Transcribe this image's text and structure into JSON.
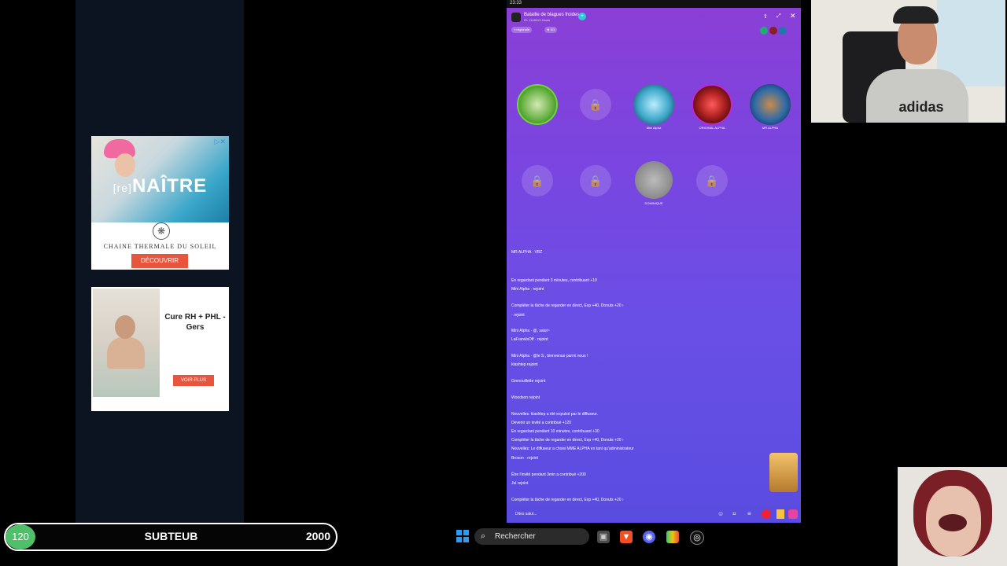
{
  "ads": {
    "ad1": {
      "headline_prefix": "[re]",
      "headline": "NAÎTRE",
      "brand": "CHAINE THERMALE DU SOLEIL",
      "cta": "DÉCOUVRIR"
    },
    "ad2": {
      "title": "Cure RH + PHL - Gers",
      "cta": "VOIR PLUS"
    }
  },
  "app": {
    "status_time": "23:33",
    "room_title": "Bataille de blagues froides",
    "room_subtitle": "ID: 1148413 Hauts",
    "chip_region": "régionale",
    "chip_count": "0/1",
    "seats_row1": [
      {
        "type": "avatar",
        "color": "#5fae3c"
      },
      {
        "type": "lock"
      },
      {
        "type": "avatar",
        "color": "#3ba6c8",
        "name": "Mini Alpha"
      },
      {
        "type": "avatar",
        "color": "#b22222",
        "name": "ORIGINAL ALPHA"
      },
      {
        "type": "avatar",
        "color": "#2d6aa8",
        "name": "MR ALPHA"
      }
    ],
    "seats_row2": [
      {
        "type": "lock"
      },
      {
        "type": "lock"
      },
      {
        "type": "avatar",
        "color": "#8a8a8a",
        "name": "DOMINIQUE"
      },
      {
        "type": "lock"
      }
    ],
    "chat": [
      {
        "text": "MR ALPHA · VBZ"
      },
      {
        "text": "En regardant pendant 3 minutes, contribuant +10"
      },
      {
        "text": "Mini Alpha · rejoint"
      },
      {
        "text": "Compléter la tâche de regarder en direct, Exp +40, Donuts +20 ›"
      },
      {
        "text": "· rejoint"
      },
      {
        "text": "Mini Alpha · @, salut~"
      },
      {
        "text": "LaFrarwlsOff · rejoint"
      },
      {
        "text": "Mini Alpha · @le S., bienvenue parmi nous !"
      },
      {
        "text": "klashtep rejoint"
      },
      {
        "text": "Grenouillette rejoint"
      },
      {
        "text": "Woodson rejoint"
      },
      {
        "text": "Nouvelles: klashtep a été expulsé par le diffuseur."
      },
      {
        "text": "Devenir un invité a contribué +120"
      },
      {
        "text": "En regardant pendant 10 minutes, contribuant +30"
      },
      {
        "text": "Compléter la tâche de regarder en direct, Exp +40, Donuts +20 ›"
      },
      {
        "text": "Nouvelles: Le diffuseur a choisi MME ALPHA en tant qu'administrateur"
      },
      {
        "text": "Broson · rejoint"
      },
      {
        "text": "Être l'invité pendant 3min a contribué +200"
      },
      {
        "text": "Jul rejoint"
      },
      {
        "text": "Compléter la tâche de regarder en direct, Exp +40, Donuts +20 ›"
      }
    ],
    "input_placeholder": "Dites salut..."
  },
  "webcam": {
    "shirt_logo": "adidas"
  },
  "goal": {
    "count": "120",
    "label": "SUBTEUB",
    "target": "2000"
  },
  "taskbar": {
    "search_label": "Rechercher"
  },
  "colors": {
    "accent_green": "#4fbf6a",
    "app_purple": "#8a3fd6",
    "cta_red": "#e8553d"
  }
}
